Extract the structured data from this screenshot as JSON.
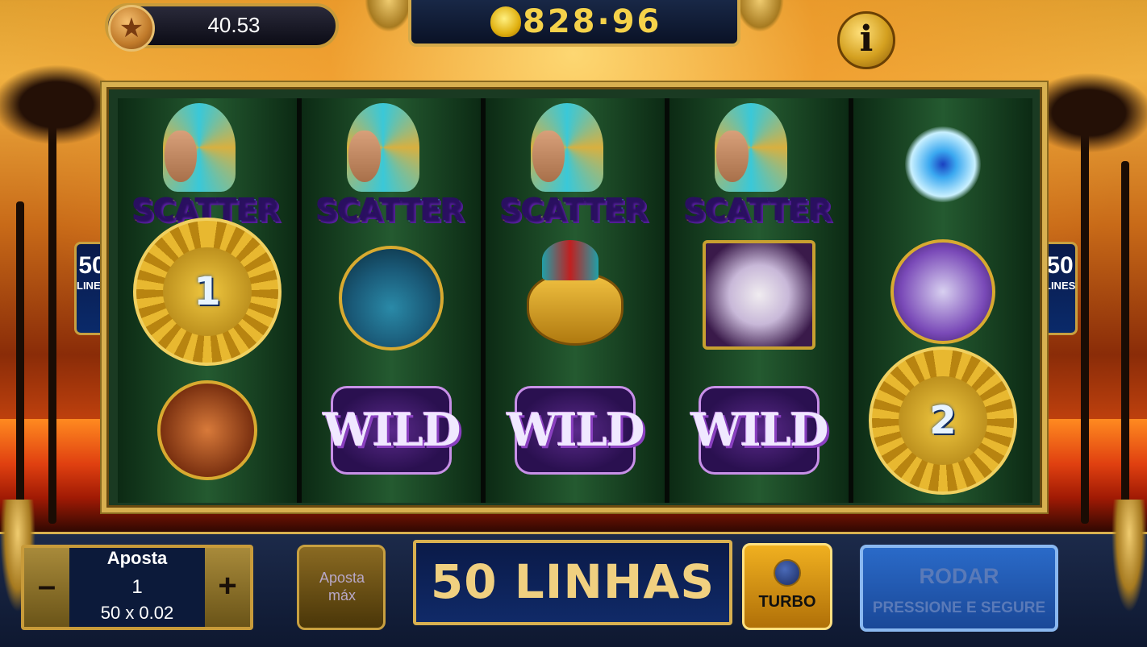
{
  "header": {
    "credits": "40.53",
    "total_win": "828·96",
    "info_label": "i"
  },
  "reels": [
    [
      "scatter",
      "coin-1",
      "pan-flute"
    ],
    [
      "scatter",
      "drum",
      "wild"
    ],
    [
      "scatter",
      "carnival-mask",
      "wild"
    ],
    [
      "scatter",
      "music-book",
      "wild"
    ],
    [
      "blue-flower",
      "maracas",
      "coin-2"
    ]
  ],
  "symbols": {
    "scatter_label": "SCATTER",
    "wild_label": "WILD",
    "coin_1_label": "1",
    "coin_2_label": "2"
  },
  "lines_badge": {
    "number": "50",
    "label": "LINES"
  },
  "bet": {
    "title": "Aposta",
    "value": "1",
    "detail": "50 x 0.02",
    "minus": "–",
    "plus": "+"
  },
  "max_bet_label": "Aposta\nmáx",
  "lines_display": "50 LINHAS",
  "turbo_label": "TURBO",
  "spin": {
    "title": "RODAR",
    "subtitle": "PRESSIONE E SEGURE"
  },
  "colors": {
    "gold": "#d8b050",
    "panel": "#0c1a3a",
    "spin": "#2a6ac8"
  }
}
